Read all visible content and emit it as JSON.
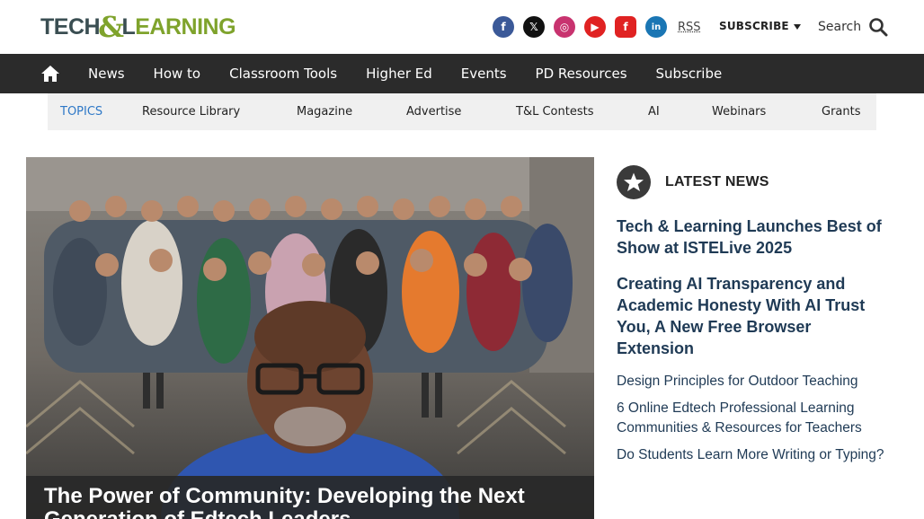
{
  "header": {
    "logo": {
      "part1": "TECH",
      "amp": "&",
      "part2": "L",
      "part3": "EARNING"
    },
    "socials": [
      {
        "name": "facebook",
        "glyph": "f"
      },
      {
        "name": "x",
        "glyph": "𝕏"
      },
      {
        "name": "instagram",
        "glyph": "◎"
      },
      {
        "name": "youtube",
        "glyph": "▶"
      },
      {
        "name": "flipboard",
        "glyph": "f"
      },
      {
        "name": "linkedin",
        "glyph": "in"
      }
    ],
    "rss_label": "RSS",
    "subscribe_label": "SUBSCRIBE",
    "search_label": "Search"
  },
  "nav": {
    "items": [
      "News",
      "How to",
      "Classroom Tools",
      "Higher Ed",
      "Events",
      "PD Resources",
      "Subscribe"
    ]
  },
  "topics": {
    "label": "TOPICS",
    "items": [
      "Resource Library",
      "Magazine",
      "Advertise",
      "T&L Contests",
      "AI",
      "Webinars",
      "Grants"
    ]
  },
  "hero": {
    "headline": "The Power of Community: Developing the Next Generation of Edtech Leaders"
  },
  "latest": {
    "title": "LATEST NEWS",
    "featured": [
      "Tech & Learning Launches Best of Show at ISTELive 2025",
      "Creating AI Transparency and Academic Honesty With AI Trust You, A New Free Browser Extension"
    ],
    "items": [
      "Design Principles for Outdoor Teaching",
      "6 Online Edtech Professional Learning Communities & Resources for Teachers",
      "Do Students Learn More Writing or Typing?"
    ]
  },
  "colors": {
    "nav_bg": "#2b2b2b",
    "topics_bg": "#f0f0f0",
    "topics_label": "#2e78c7",
    "headline_link": "#1f3a55",
    "logo_green": "#7fa32c"
  }
}
